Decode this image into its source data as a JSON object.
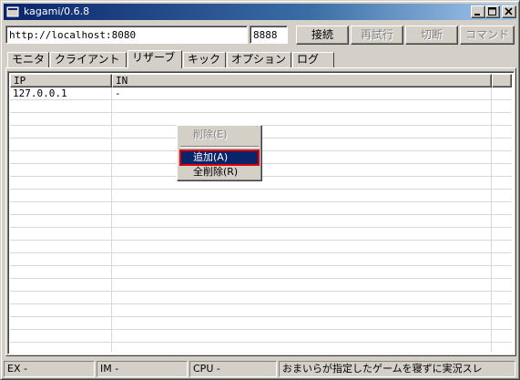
{
  "window": {
    "title": "kagami/0.6.8"
  },
  "toolbar": {
    "url_value": "http://localhost:8080",
    "port_value": "8888",
    "connect_label": "接続",
    "retry_label": "再試行",
    "disconnect_label": "切断",
    "command_label": "コマンド"
  },
  "tabs": [
    {
      "label": "モニタ"
    },
    {
      "label": "クライアント"
    },
    {
      "label": "リザーブ"
    },
    {
      "label": "キック"
    },
    {
      "label": "オプション"
    },
    {
      "label": "ログ"
    }
  ],
  "active_tab": "リザーブ",
  "table": {
    "columns": [
      "IP",
      "IN"
    ],
    "rows": [
      {
        "ip": "127.0.0.1",
        "in": "-"
      }
    ]
  },
  "context_menu": {
    "items": [
      {
        "label": "削除(E)",
        "state": "disabled"
      },
      {
        "label": "追加(A)",
        "state": "selected"
      },
      {
        "label": "全削除(R)",
        "state": "enabled"
      }
    ]
  },
  "statusbar": {
    "ex": "EX -",
    "im": "IM -",
    "cpu": "CPU -",
    "message": "おまいらが指定したゲームを寝ずに実況スレ"
  },
  "colors": {
    "face": "#d4d0c8",
    "title_active": "#0a246a",
    "selection": "#0a246a",
    "selection_outline": "#e00000"
  },
  "icons": {
    "app": "app-window-icon",
    "minimize": "minimize-icon",
    "maximize": "maximize-icon",
    "close": "close-icon"
  }
}
